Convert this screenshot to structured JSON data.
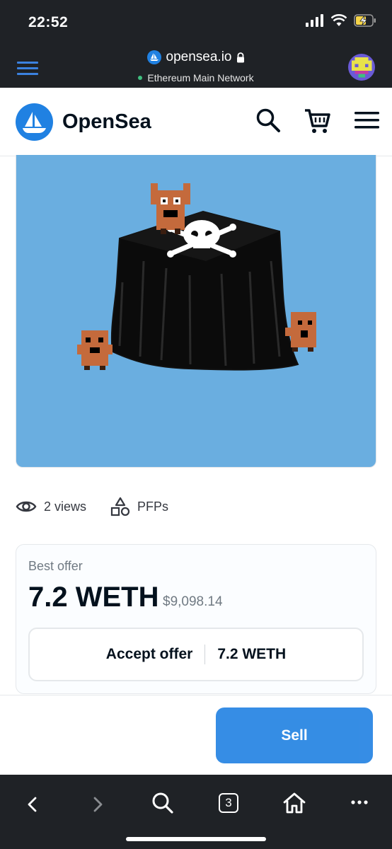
{
  "status_bar": {
    "time": "22:52"
  },
  "browser": {
    "host": "opensea.io",
    "network": "Ethereum Main Network"
  },
  "header": {
    "brand": "OpenSea"
  },
  "stats": {
    "views": "2 views",
    "category": "PFPs"
  },
  "offer": {
    "label": "Best offer",
    "price": "7.2 WETH",
    "usd": "$9,098.14",
    "accept_label": "Accept offer",
    "accept_price": "7.2 WETH"
  },
  "footer": {
    "sell_label": "Sell"
  },
  "toolbar": {
    "tab_count": "3"
  },
  "colors": {
    "accent": "#2081e2",
    "image_bg": "#6aaee0",
    "dark_bar": "#1f2226"
  },
  "icons": [
    "hamburger-icon",
    "opensea-icon",
    "lock-icon",
    "search-icon",
    "cart-icon",
    "menu-icon",
    "eye-icon",
    "shapes-icon",
    "back-icon",
    "forward-icon",
    "tabs-icon",
    "home-icon",
    "more-icon"
  ]
}
